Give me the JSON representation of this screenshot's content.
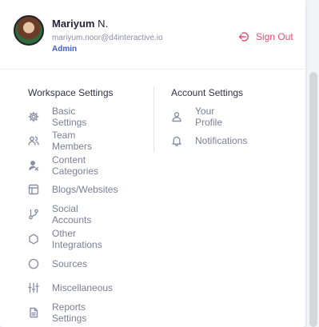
{
  "user": {
    "name": "Mariyum",
    "last_initial": "N.",
    "email": "mariyum.noor@d4interactive.io",
    "role": "Admin"
  },
  "signout": {
    "label": "Sign Out",
    "icon": "sign-out-icon",
    "color": "#f04a6b"
  },
  "workspace": {
    "title": "Workspace Settings",
    "items": [
      {
        "label": "Basic Settings",
        "icon": "gear-icon"
      },
      {
        "label": "Team Members",
        "icon": "users-icon"
      },
      {
        "label": "Content Categories",
        "icon": "category-person-icon"
      },
      {
        "label": "Blogs/Websites",
        "icon": "layout-icon"
      },
      {
        "label": "Social Accounts",
        "icon": "git-branch-icon"
      },
      {
        "label": "Other Integrations",
        "icon": "hexagon-icon"
      },
      {
        "label": "Sources",
        "icon": "circle-icon"
      },
      {
        "label": "Miscellaneous",
        "icon": "sliders-icon"
      },
      {
        "label": "Reports Settings",
        "icon": "document-icon"
      }
    ]
  },
  "account": {
    "title": "Account Settings",
    "items": [
      {
        "label": "Your Profile",
        "icon": "user-icon"
      },
      {
        "label": "Notifications",
        "icon": "bell-icon"
      }
    ]
  },
  "colors": {
    "accent": "#3d5cd6",
    "text_dark": "#232438",
    "text_muted": "#7a7f96"
  }
}
